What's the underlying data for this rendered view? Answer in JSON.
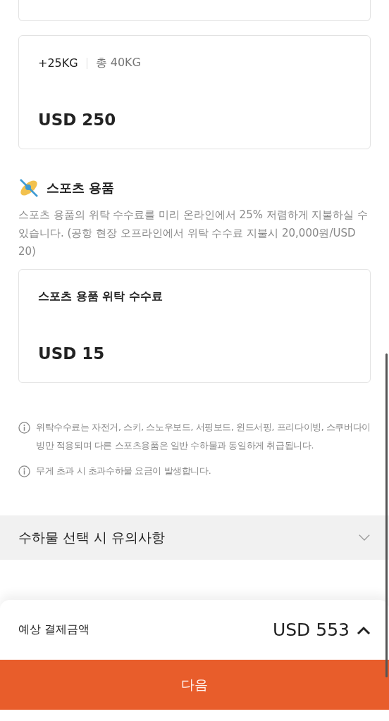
{
  "cards_top": [
    {
      "kind": "empty"
    }
  ],
  "baggage_card": {
    "weight": "+25KG",
    "total": "총 40KG",
    "price": "USD 250"
  },
  "sports": {
    "title": "스포츠 용품",
    "description": "스포츠 용품의 위탁 수수료를 미리 온라인에서 25% 저렴하게 지불하실 수 있습니다. (공항 현장 오프라인에서 위탁 수수료 지불시 20,000원/USD 20)",
    "card": {
      "label": "스포츠 용품 위탁 수수료",
      "price": "USD 15"
    }
  },
  "notes": [
    "위탁수수료는 자전거, 스키, 스노우보드, 서핑보드, 윈드서핑, 프리다이빙, 스쿠버다이빙만 적용되며 다른 스포츠용품은 일반 수하물과 동일하게 취급됩니다.",
    "무게 초과 시 초과수하물 요금이 발생합니다."
  ],
  "accordion": {
    "title": "수하물 선택 시 유의사항",
    "expanded": false
  },
  "summary": {
    "label": "예상 결제금액",
    "amount": "USD 553",
    "expanded": false
  },
  "next_button": "다음"
}
